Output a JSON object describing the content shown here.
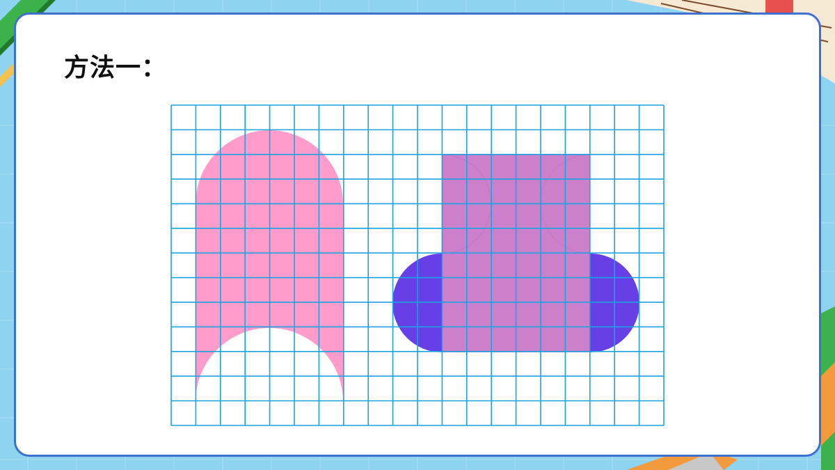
{
  "title": "方法一：",
  "colors": {
    "background": "#8ed3f0",
    "card_border": "#3f6fcf",
    "grid_line": "#1aa3e0",
    "pink_shape": "#ff9ccb",
    "purple_square": "#cc80cc",
    "blue_half_circles": "#6640e6"
  },
  "figure": {
    "grid_columns": 20,
    "grid_rows": 13,
    "left_shape": "arch with a semicircle removed from the bottom",
    "right_shape": "square with two quarter circles moved to the sides as half circles"
  }
}
